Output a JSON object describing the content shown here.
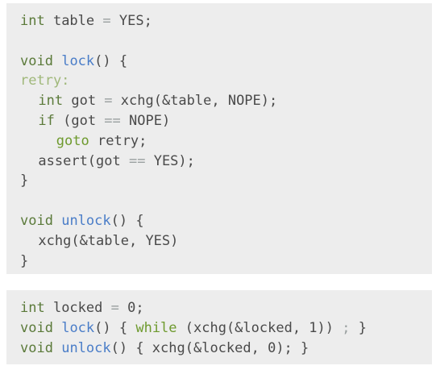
{
  "code_block_1": {
    "lines": [
      {
        "indent": 0,
        "tokens": [
          {
            "t": "int",
            "c": "kw"
          },
          {
            "t": " table ",
            "c": "txt"
          },
          {
            "t": "=",
            "c": "op"
          },
          {
            "t": " YES;",
            "c": "txt"
          }
        ]
      },
      {
        "indent": 0,
        "tokens": []
      },
      {
        "indent": 0,
        "tokens": [
          {
            "t": "void",
            "c": "kw"
          },
          {
            "t": " ",
            "c": "txt"
          },
          {
            "t": "lock",
            "c": "fn"
          },
          {
            "t": "() {",
            "c": "txt"
          }
        ]
      },
      {
        "indent": 0,
        "tokens": [
          {
            "t": "retry:",
            "c": "lbl"
          }
        ]
      },
      {
        "indent": 2,
        "tokens": [
          {
            "t": "int",
            "c": "kw"
          },
          {
            "t": " got ",
            "c": "txt"
          },
          {
            "t": "=",
            "c": "op"
          },
          {
            "t": " xchg(&table, NOPE);",
            "c": "txt"
          }
        ]
      },
      {
        "indent": 2,
        "tokens": [
          {
            "t": "if",
            "c": "kw"
          },
          {
            "t": " (got ",
            "c": "txt"
          },
          {
            "t": "==",
            "c": "op"
          },
          {
            "t": " NOPE)",
            "c": "txt"
          }
        ]
      },
      {
        "indent": 4,
        "tokens": [
          {
            "t": "goto",
            "c": "goto"
          },
          {
            "t": " retry;",
            "c": "txt"
          }
        ]
      },
      {
        "indent": 2,
        "tokens": [
          {
            "t": "assert(got ",
            "c": "txt"
          },
          {
            "t": "==",
            "c": "op"
          },
          {
            "t": " YES);",
            "c": "txt"
          }
        ]
      },
      {
        "indent": 0,
        "tokens": [
          {
            "t": "}",
            "c": "txt"
          }
        ]
      },
      {
        "indent": 0,
        "tokens": []
      },
      {
        "indent": 0,
        "tokens": [
          {
            "t": "void",
            "c": "kw"
          },
          {
            "t": " ",
            "c": "txt"
          },
          {
            "t": "unlock",
            "c": "fn"
          },
          {
            "t": "() {",
            "c": "txt"
          }
        ]
      },
      {
        "indent": 2,
        "tokens": [
          {
            "t": "xchg(&table, YES)",
            "c": "txt"
          }
        ]
      },
      {
        "indent": 0,
        "tokens": [
          {
            "t": "}",
            "c": "txt"
          }
        ]
      }
    ]
  },
  "code_block_2": {
    "lines": [
      {
        "indent": 0,
        "tokens": [
          {
            "t": "int",
            "c": "kw"
          },
          {
            "t": " locked ",
            "c": "txt"
          },
          {
            "t": "=",
            "c": "op"
          },
          {
            "t": " 0;",
            "c": "txt"
          }
        ]
      },
      {
        "indent": 0,
        "tokens": [
          {
            "t": "void",
            "c": "kw"
          },
          {
            "t": " ",
            "c": "txt"
          },
          {
            "t": "lock",
            "c": "fn"
          },
          {
            "t": "() { ",
            "c": "txt"
          },
          {
            "t": "while",
            "c": "goto"
          },
          {
            "t": " (xchg(&locked, 1)) ",
            "c": "txt"
          },
          {
            "t": ";",
            "c": "op"
          },
          {
            "t": " }",
            "c": "txt"
          }
        ]
      },
      {
        "indent": 0,
        "tokens": [
          {
            "t": "void",
            "c": "kw"
          },
          {
            "t": " ",
            "c": "txt"
          },
          {
            "t": "unlock",
            "c": "fn"
          },
          {
            "t": "() { xchg(&locked, 0); }",
            "c": "txt"
          }
        ]
      }
    ]
  },
  "colors": {
    "background": "#ffffff",
    "block": "#ededed",
    "keyword": "#5b7a3a",
    "function": "#4a7dc8",
    "label": "#a0b87a",
    "control": "#6e9a2e",
    "operator": "#9aa0a0",
    "text": "#4a4a4a"
  }
}
